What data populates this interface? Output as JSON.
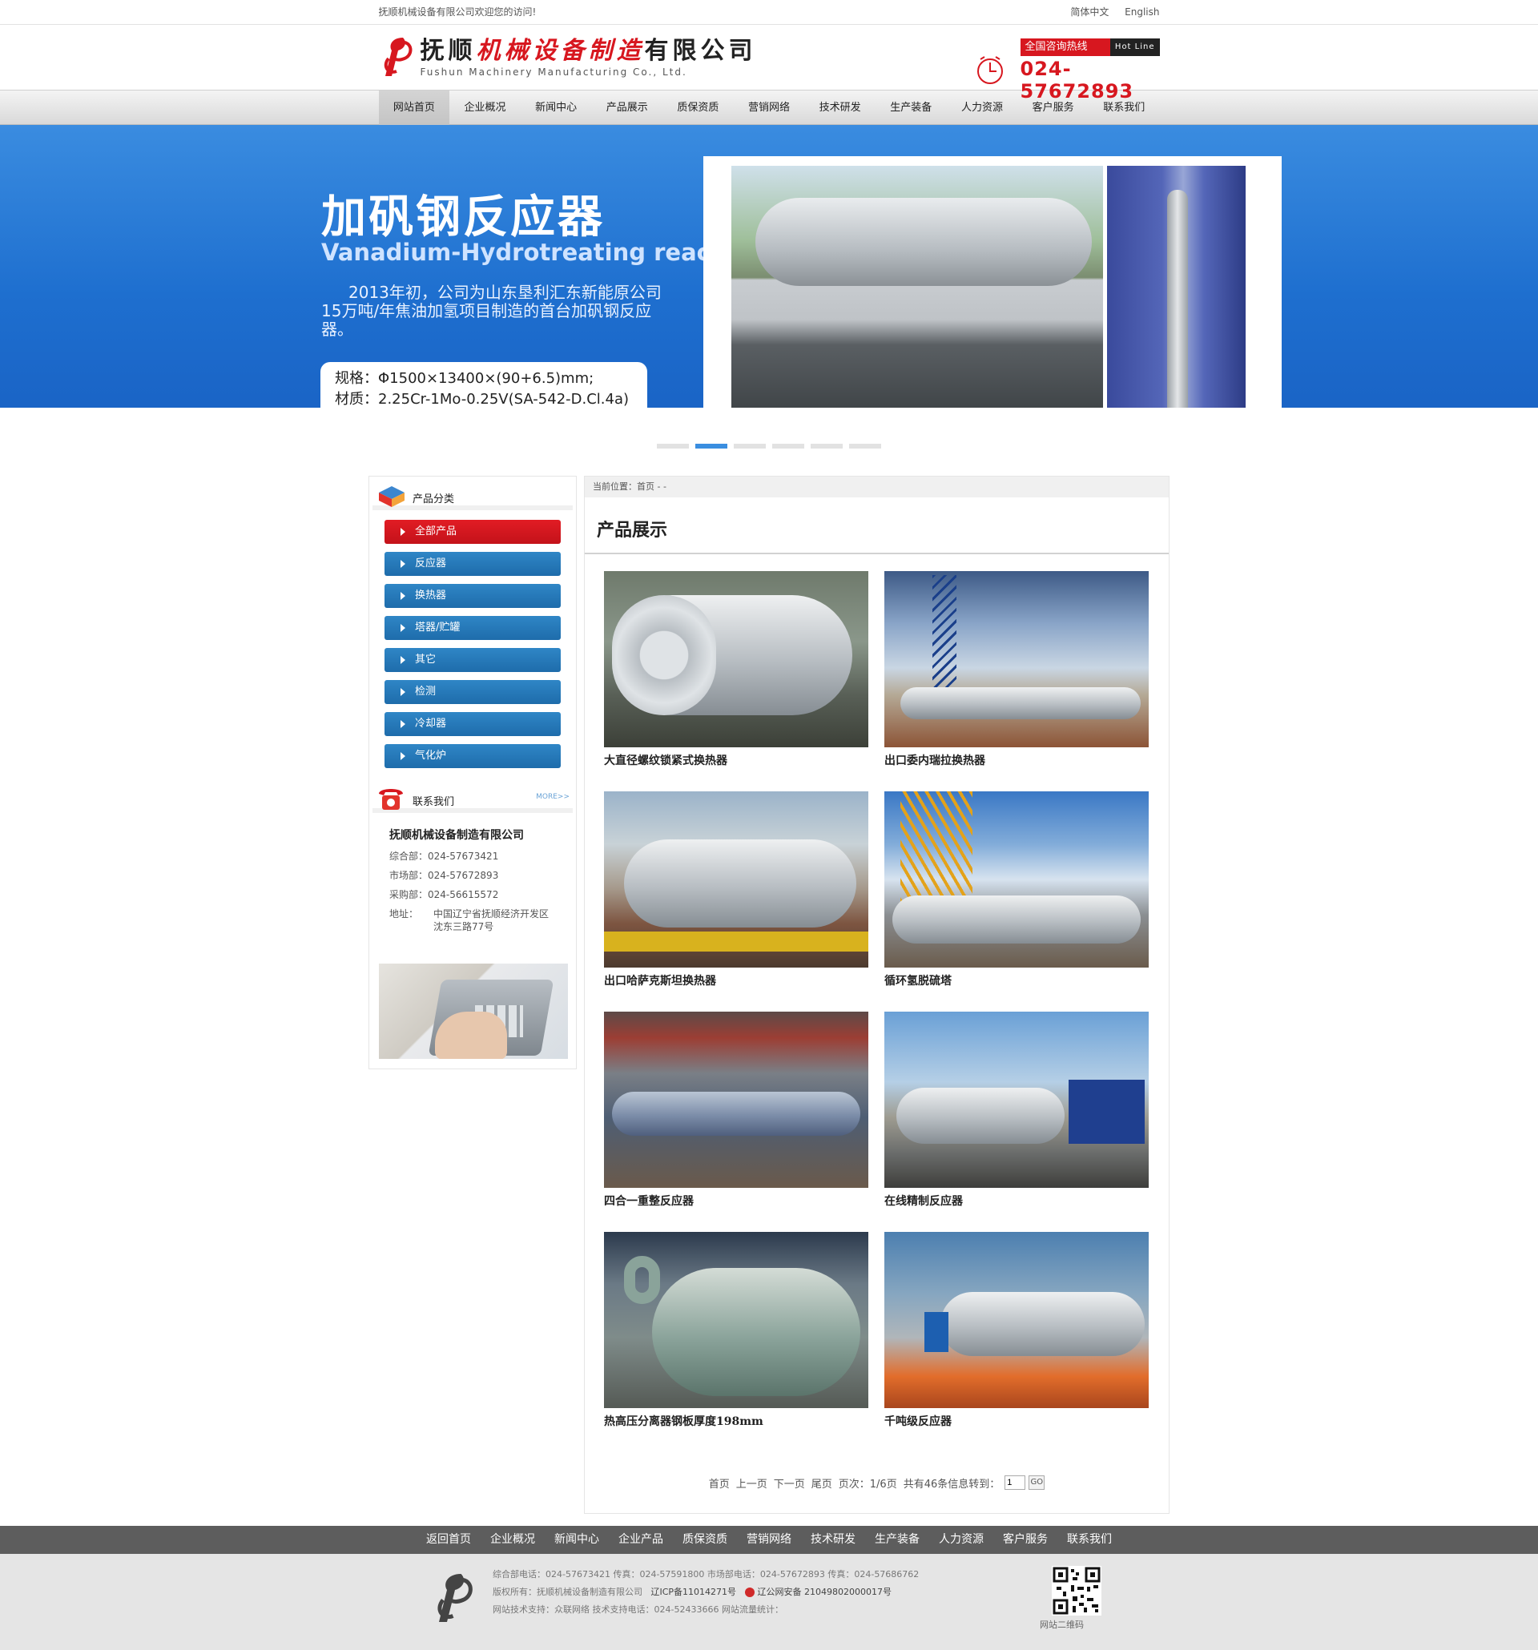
{
  "topbar": {
    "welcome": "抚顺机械设备有限公司欢迎您的访问!",
    "lang_cn": "简体中文",
    "lang_en": "English"
  },
  "header": {
    "logo_cn_black1": "抚顺",
    "logo_cn_red": "机械设备制造",
    "logo_cn_black2": "有限公司",
    "logo_en": "Fushun Machinery Manufacturing Co., Ltd.",
    "hotline_cn": "全国咨询热线",
    "hotline_en": "Hot Line",
    "hotline_number": "024-57672893"
  },
  "nav": [
    {
      "label": "网站首页",
      "active": true
    },
    {
      "label": "企业概况"
    },
    {
      "label": "新闻中心"
    },
    {
      "label": "产品展示"
    },
    {
      "label": "质保资质"
    },
    {
      "label": "营销网络"
    },
    {
      "label": "技术研发"
    },
    {
      "label": "生产装备"
    },
    {
      "label": "人力资源"
    },
    {
      "label": "客户服务"
    },
    {
      "label": "联系我们"
    }
  ],
  "banner": {
    "title": "加矾钢反应器",
    "subtitle": "Vanadium-Hydrotreating reactor",
    "desc": "2013年初，公司为山东垦利汇东新能原公司15万吨/年焦油加氢项目制造的首台加矾钢反应器。",
    "spec1": "规格：Φ1500×13400×(90+6.5)mm;",
    "spec2": "材质：2.25Cr-1Mo-0.25V(SA-542-D.Cl.4a)",
    "slides_total": 6,
    "active_slide": 2
  },
  "sidebar": {
    "category_title": "产品分类",
    "categories": [
      {
        "label": "全部产品",
        "active": true
      },
      {
        "label": "反应器"
      },
      {
        "label": "换热器"
      },
      {
        "label": "塔器/贮罐"
      },
      {
        "label": "其它"
      },
      {
        "label": "检测"
      },
      {
        "label": "冷却器"
      },
      {
        "label": "气化炉"
      }
    ],
    "contact_title": "联系我们",
    "contact_more": "MORE>>",
    "company": "抚顺机械设备制造有限公司",
    "lines": [
      {
        "label": "综合部：",
        "value": "024-57673421"
      },
      {
        "label": "市场部：",
        "value": "024-57672893"
      },
      {
        "label": "采购部：",
        "value": "024-56615572"
      }
    ],
    "address_label": "地址：",
    "address_line1": "中国辽宁省抚顺经济开发区",
    "address_line2": "沈东三路77号"
  },
  "content": {
    "breadcrumb": "当前位置：首页 - -",
    "title": "产品展示",
    "products": [
      {
        "name": "大直径螺纹锁紧式换热器"
      },
      {
        "name": "出口委内瑞拉换热器"
      },
      {
        "name": "出口哈萨克斯坦换热器"
      },
      {
        "name": "循环氢脱硫塔"
      },
      {
        "name": "四合一重整反应器"
      },
      {
        "name": "在线精制反应器"
      },
      {
        "name": "热高压分离器钢板厚度198mm"
      },
      {
        "name": "千吨级反应器"
      }
    ],
    "pager": {
      "first": "首页",
      "prev": "上一页",
      "next": "下一页",
      "last": "尾页",
      "page_info": "页次：1/6页",
      "total": "共有46条信息转到：",
      "page_value": "1",
      "go": "GO"
    }
  },
  "footer": {
    "nav": [
      "返回首页",
      "企业概况",
      "新闻中心",
      "企业产品",
      "质保资质",
      "营销网络",
      "技术研发",
      "生产装备",
      "人力资源",
      "客户服务",
      "联系我们"
    ],
    "line1": "综合部电话：024-57673421  传真：024-57591800    市场部电话：024-57672893  传真：024-57686762",
    "line2_a": "版权所有：抚顺机械设备制造有限公司",
    "line2_b": "辽ICP备11014271号",
    "line2_c": "辽公网安备 21049802000017号",
    "line3": "网站技术支持：众联网络    技术支持电话：024-52433666    网站流量统计：",
    "qr_label": "网站二维码"
  }
}
